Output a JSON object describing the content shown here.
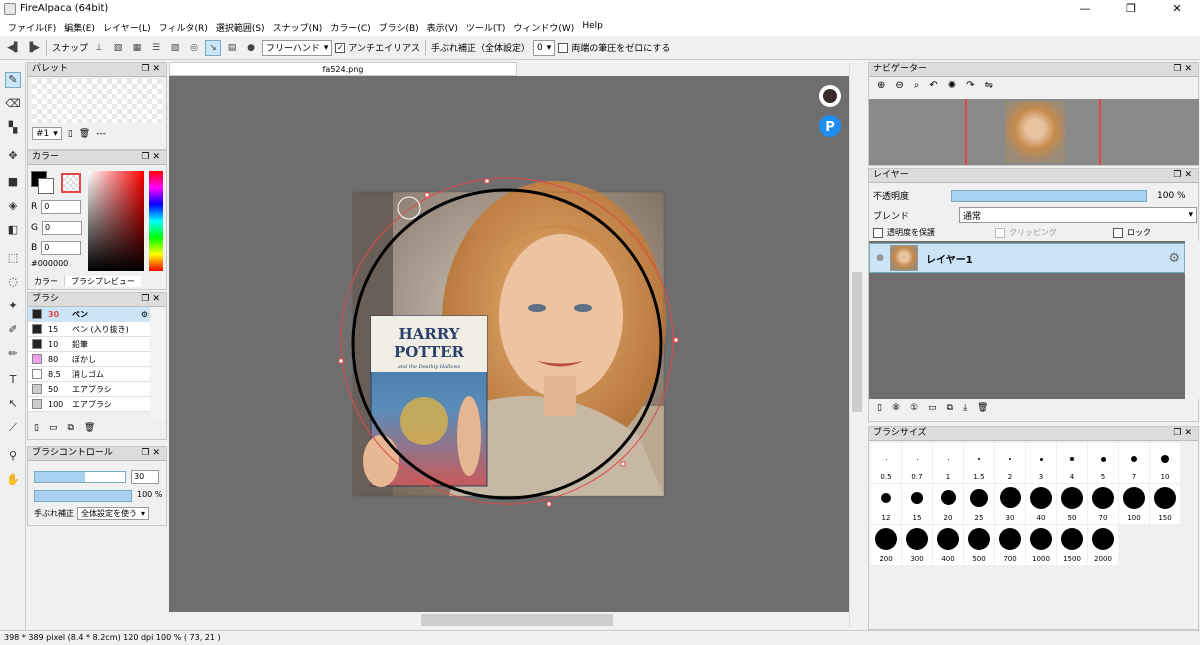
{
  "window": {
    "title": "FireAlpaca (64bit)",
    "min": "—",
    "max": "❐",
    "close": "✕"
  },
  "menu": [
    "ファイル(F)",
    "編集(E)",
    "レイヤー(L)",
    "フィルタ(R)",
    "選択範囲(S)",
    "スナップ(N)",
    "カラー(C)",
    "ブラシ(B)",
    "表示(V)",
    "ツール(T)",
    "ウィンドウ(W)",
    "Help"
  ],
  "toolbar": {
    "snap_label": "スナップ",
    "freehand": "フリーハンド",
    "antialias": "アンチエイリアス",
    "stabilizer_label": "手ぶれ補正（全体設定）",
    "stabilizer_value": "0",
    "both_ends": "両端の筆圧をゼロにする"
  },
  "document": {
    "tab": "fa524.png"
  },
  "palette": {
    "title": "パレット",
    "set": "#1",
    "name": "---"
  },
  "color": {
    "title": "カラー",
    "r": "0",
    "g": "0",
    "b": "0",
    "hex": "#000000",
    "tab_color": "カラー",
    "tab_preview": "ブラシプレビュー",
    "r_label": "R",
    "g_label": "G",
    "b_label": "B"
  },
  "brush": {
    "title": "ブラシ",
    "items": [
      {
        "size": "30",
        "name": "ペン",
        "swatch": "#222222",
        "selected": true
      },
      {
        "size": "15",
        "name": "ペン (入り抜き)",
        "swatch": "#222222"
      },
      {
        "size": "10",
        "name": "鉛筆",
        "swatch": "#222222"
      },
      {
        "size": "80",
        "name": "ぼかし",
        "swatch": "#f0a0e8"
      },
      {
        "size": "8.5",
        "name": "消しゴム",
        "swatch": "#ffffff"
      },
      {
        "size": "50",
        "name": "エアブラシ",
        "swatch": "#cccccc"
      },
      {
        "size": "100",
        "name": "エアブラシ",
        "swatch": "#cccccc"
      }
    ]
  },
  "brush_control": {
    "title": "ブラシコントロール",
    "size": "30",
    "opacity": "100 %",
    "opacity_fraction": 1.0,
    "stab_label": "手ぶれ補正",
    "stab_value": "全体設定を使う"
  },
  "navigator": {
    "title": "ナビゲーター"
  },
  "layer": {
    "title": "レイヤー",
    "opacity_label": "不透明度",
    "opacity_value": "100 %",
    "opacity_fraction": 1.0,
    "blend_label": "ブレンド",
    "blend_value": "通常",
    "protect_alpha": "透明度を保護",
    "clipping": "クリッピング",
    "lock": "ロック",
    "layer_name": "レイヤー1"
  },
  "brush_size": {
    "title": "ブラシサイズ",
    "sizes": [
      "0.5",
      "0.7",
      "1",
      "1.5",
      "2",
      "3",
      "4",
      "5",
      "7",
      "10",
      "12",
      "15",
      "20",
      "25",
      "30",
      "40",
      "50",
      "70",
      "100",
      "150",
      "200",
      "300",
      "400",
      "500",
      "700",
      "1000",
      "1500",
      "2000"
    ]
  },
  "status": {
    "text": "398 * 389 pixel   (8.4 * 8.2cm)   120 dpi   100 %   ( 73, 21 )"
  },
  "photo": {
    "book_title_1": "HARRY",
    "book_title_2": "POTTER",
    "book_subtitle": "and the Deathly Hallows"
  },
  "colors": {
    "accent": "#cce4f7",
    "canvas_bg": "#6e6e6e",
    "guide": "#e04848"
  }
}
